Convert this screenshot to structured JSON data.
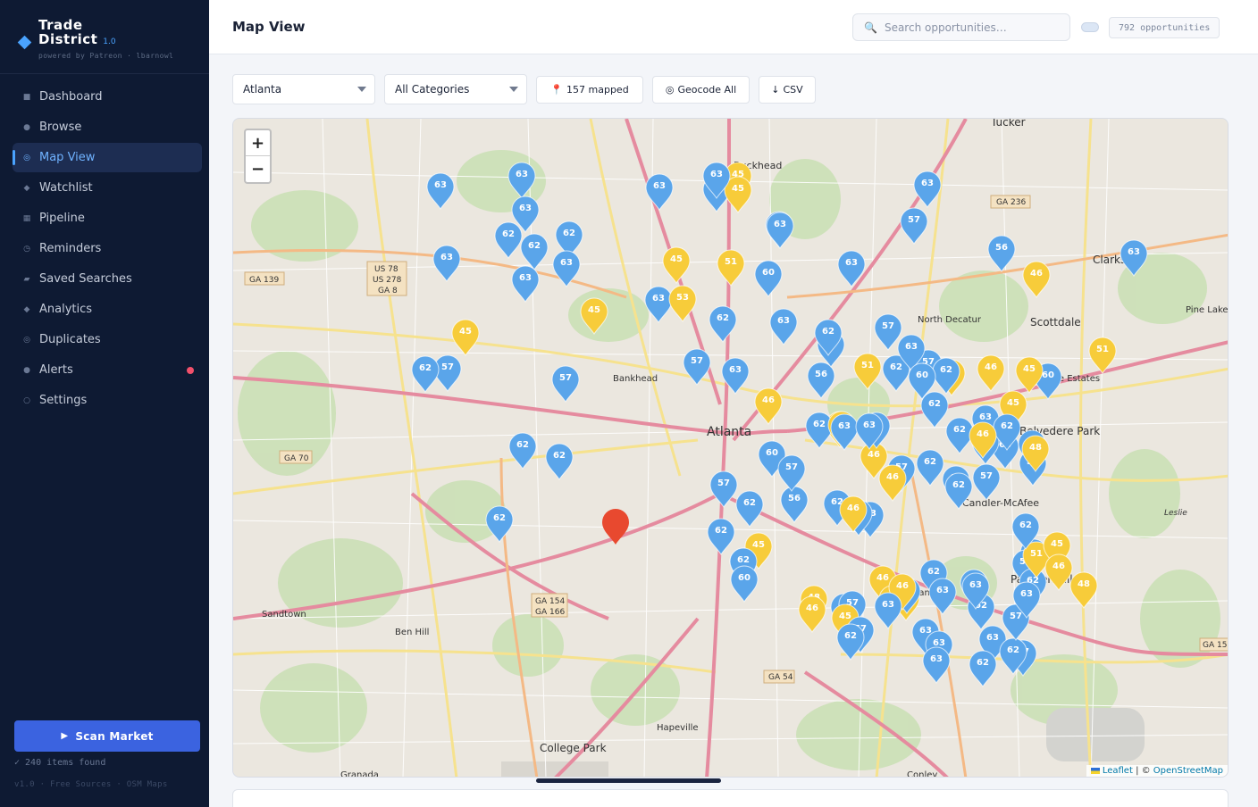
{
  "brand": {
    "title_line1": "Trade",
    "title_line2": "District",
    "version": "1.0",
    "subtitle": "powered by Patreon · lbarnowl"
  },
  "nav": {
    "items": [
      {
        "label": "Dashboard",
        "icon": "square-icon"
      },
      {
        "label": "Browse",
        "icon": "dot-icon"
      },
      {
        "label": "Map View",
        "icon": "target-icon",
        "active": true
      },
      {
        "label": "Watchlist",
        "icon": "diamond-icon"
      },
      {
        "label": "Pipeline",
        "icon": "grid-icon"
      },
      {
        "label": "Reminders",
        "icon": "clock-icon"
      },
      {
        "label": "Saved Searches",
        "icon": "bookmark-icon"
      },
      {
        "label": "Analytics",
        "icon": "diamond-icon"
      },
      {
        "label": "Duplicates",
        "icon": "target-icon"
      },
      {
        "label": "Alerts",
        "icon": "dot-icon",
        "badge_color": "#f2506b"
      },
      {
        "label": "Settings",
        "icon": "circle-icon"
      }
    ]
  },
  "sidebar_footer": {
    "scan_label": "Scan Market",
    "items_found": "✓ 240 items found",
    "note": "v1.0 · Free Sources · OSM Maps"
  },
  "header": {
    "title": "Map View",
    "search_placeholder": "Search opportunities…",
    "count": "792 opportunities"
  },
  "filters": {
    "city": "Atlanta",
    "category": "All Categories",
    "mapped": "157 mapped",
    "geocode_label": "Geocode All",
    "csv_label": "CSV"
  },
  "map": {
    "zoom_in": "+",
    "zoom_out": "−",
    "attribution_leaflet": "Leaflet",
    "attribution_sep": " | © ",
    "attribution_osm": "OpenStreetMap",
    "labels": [
      "Tucker",
      "Buckhead",
      "Clarkston",
      "Scottdale",
      "North Decatur",
      "Pine Lake",
      "Avondale Estates",
      "Belvedere Park",
      "Atlanta",
      "Bankhead",
      "Sandtown",
      "Ben Hill",
      "College Park",
      "Hapeville",
      "Panthersville",
      "Gresham Park",
      "Candler-McAfee",
      "Conley",
      "Granada",
      "Leslie"
    ],
    "route_shields": [
      "US 78",
      "US 278",
      "GA 8",
      "GA 139",
      "GA 236",
      "GA 70",
      "GA 154",
      "GA 166",
      "GA 54",
      "GA 15"
    ],
    "markers": [
      {
        "v": "63",
        "c": "b"
      },
      {
        "v": "63",
        "c": "b"
      },
      {
        "v": "63",
        "c": "b"
      },
      {
        "v": "45",
        "c": "y"
      },
      {
        "v": "63",
        "c": "b"
      },
      {
        "v": "45",
        "c": "y"
      },
      {
        "v": "63",
        "c": "b"
      },
      {
        "v": "63",
        "c": "b"
      },
      {
        "v": "57",
        "c": "b"
      },
      {
        "v": "62",
        "c": "b"
      },
      {
        "v": "45",
        "c": "y"
      },
      {
        "v": "62",
        "c": "b"
      },
      {
        "v": "62",
        "c": "b"
      },
      {
        "v": "62",
        "c": "b"
      },
      {
        "v": "62",
        "c": "b"
      },
      {
        "v": "62",
        "c": "b"
      },
      {
        "v": "63",
        "c": "b"
      },
      {
        "v": "62",
        "c": "b"
      },
      {
        "v": "57",
        "c": "b"
      },
      {
        "v": "63",
        "c": "b"
      },
      {
        "v": "45",
        "c": "y"
      },
      {
        "v": "51",
        "c": "y"
      },
      {
        "v": "60",
        "c": "b"
      },
      {
        "v": "63",
        "c": "b"
      },
      {
        "v": "57",
        "c": "b"
      },
      {
        "v": "56",
        "c": "b"
      },
      {
        "v": "46",
        "c": "y"
      },
      {
        "v": "63",
        "c": "b"
      },
      {
        "v": "63",
        "c": "b"
      },
      {
        "v": "63",
        "c": "b"
      },
      {
        "v": "63",
        "c": "b"
      },
      {
        "v": "45",
        "c": "y"
      },
      {
        "v": "63",
        "c": "b"
      },
      {
        "v": "53",
        "c": "y"
      },
      {
        "v": "62",
        "c": "b"
      },
      {
        "v": "63",
        "c": "b"
      },
      {
        "v": "57",
        "c": "b"
      },
      {
        "v": "63",
        "c": "b"
      },
      {
        "v": "56",
        "c": "b"
      },
      {
        "v": "62",
        "c": "b"
      },
      {
        "v": "46",
        "c": "y"
      },
      {
        "v": "45",
        "c": "y"
      },
      {
        "v": "51",
        "c": "y"
      },
      {
        "v": "62",
        "c": "b"
      },
      {
        "v": "57",
        "c": "b"
      },
      {
        "v": "51",
        "c": "y"
      },
      {
        "v": "63",
        "c": "b"
      },
      {
        "v": "57",
        "c": "b"
      },
      {
        "v": "62",
        "c": "b"
      },
      {
        "v": "46",
        "c": "y"
      },
      {
        "v": "56",
        "c": "b"
      },
      {
        "v": "63",
        "c": "b"
      },
      {
        "v": "63",
        "c": "b"
      },
      {
        "v": "51",
        "c": "y"
      },
      {
        "v": "60",
        "c": "b"
      },
      {
        "v": "45",
        "c": "y"
      },
      {
        "v": "46",
        "c": "y"
      },
      {
        "v": "62",
        "c": "b"
      },
      {
        "v": "62",
        "c": "b"
      },
      {
        "v": "63",
        "c": "b"
      },
      {
        "v": "45",
        "c": "y"
      },
      {
        "v": "63",
        "c": "b"
      },
      {
        "v": "62",
        "c": "b"
      },
      {
        "v": "63",
        "c": "b"
      },
      {
        "v": "62",
        "c": "b"
      },
      {
        "v": "62",
        "c": "b"
      },
      {
        "v": "60",
        "c": "b"
      },
      {
        "v": "62",
        "c": "b"
      },
      {
        "v": "57",
        "c": "b"
      },
      {
        "v": "63",
        "c": "b"
      },
      {
        "v": "62",
        "c": "b"
      },
      {
        "v": "60",
        "c": "b"
      },
      {
        "v": "63",
        "c": "b"
      },
      {
        "v": "45",
        "c": "y"
      },
      {
        "v": "62",
        "c": "b"
      },
      {
        "v": "63",
        "c": "b"
      },
      {
        "v": "62",
        "c": "b"
      },
      {
        "v": "63",
        "c": "b"
      },
      {
        "v": "56",
        "c": "b"
      },
      {
        "v": "60",
        "c": "b"
      },
      {
        "v": "46",
        "c": "y"
      },
      {
        "v": "62",
        "c": "b"
      },
      {
        "v": "62",
        "c": "b"
      },
      {
        "v": "57",
        "c": "b"
      },
      {
        "v": "57",
        "c": "b"
      },
      {
        "v": "46",
        "c": "y"
      },
      {
        "v": "62",
        "c": "b"
      },
      {
        "v": "57",
        "c": "b"
      },
      {
        "v": "56",
        "c": "b"
      },
      {
        "v": "48",
        "c": "y"
      },
      {
        "v": "46",
        "c": "y"
      },
      {
        "v": "45",
        "c": "y"
      },
      {
        "v": "62",
        "c": "b"
      },
      {
        "v": "60",
        "c": "b"
      },
      {
        "v": "62",
        "c": "b"
      },
      {
        "v": "46",
        "c": "y"
      },
      {
        "v": "45",
        "c": "y"
      },
      {
        "v": "60",
        "c": "b"
      },
      {
        "v": "62",
        "c": "b"
      },
      {
        "v": "62",
        "c": "b"
      },
      {
        "v": "63",
        "c": "b"
      },
      {
        "v": "45",
        "c": "y"
      },
      {
        "v": "57",
        "c": "b"
      },
      {
        "v": "62",
        "c": "b"
      },
      {
        "v": "46",
        "c": "y"
      },
      {
        "v": "48",
        "c": "y"
      },
      {
        "v": "45",
        "c": "y"
      },
      {
        "v": "57",
        "c": "b"
      },
      {
        "v": "46",
        "c": "y"
      },
      {
        "v": "62",
        "c": "b"
      },
      {
        "v": "63",
        "c": "b"
      },
      {
        "v": "63",
        "c": "b"
      },
      {
        "v": "63",
        "c": "b"
      },
      {
        "v": "63",
        "c": "b"
      },
      {
        "v": "63",
        "c": "b"
      },
      {
        "v": "62",
        "c": "b"
      },
      {
        "v": "57",
        "c": "b"
      },
      {
        "v": "63",
        "c": "b"
      },
      {
        "v": "57",
        "c": "b"
      },
      {
        "v": "62",
        "c": "b"
      },
      {
        "v": "62",
        "c": "b"
      },
      {
        "v": "57",
        "c": "b"
      },
      {
        "v": "63",
        "c": "b"
      },
      {
        "v": "63",
        "c": "b"
      },
      {
        "v": "51",
        "c": "y"
      },
      {
        "v": "62",
        "c": "b"
      },
      {
        "v": "45",
        "c": "y"
      },
      {
        "v": "48",
        "c": "y"
      },
      {
        "v": "46",
        "c": "y"
      }
    ]
  },
  "colors": {
    "marker_blue": "#5aa5ea",
    "marker_yellow": "#f7cc3a",
    "marker_red": "#e8492f",
    "accent": "#3b63e0"
  }
}
